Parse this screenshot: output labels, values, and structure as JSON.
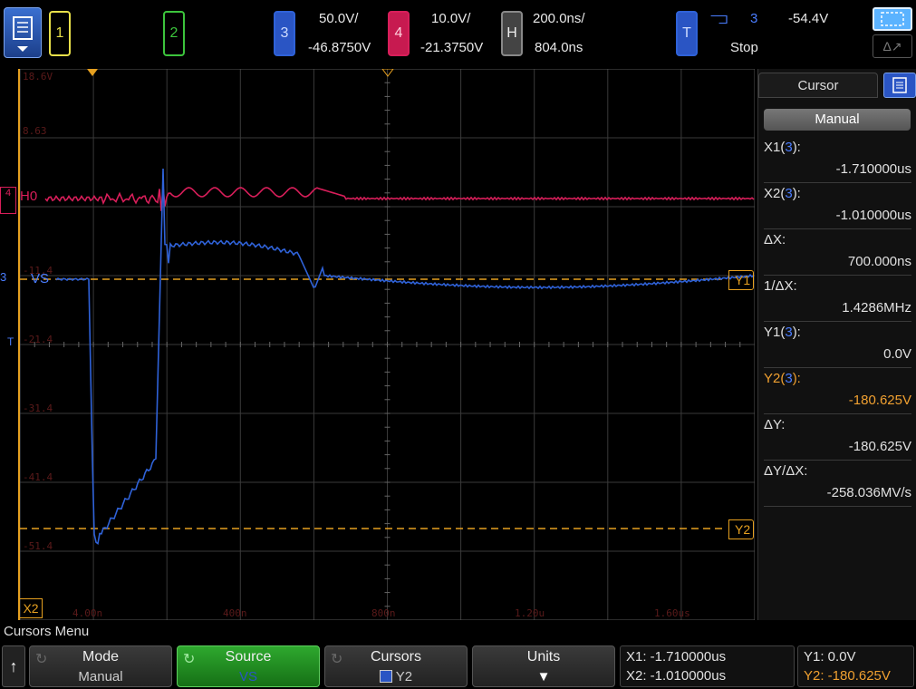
{
  "top": {
    "ch1_label": "1",
    "ch2_label": "2",
    "ch3_label": "3",
    "ch3_scale": "50.0V/",
    "ch3_offset": "-46.8750V",
    "ch4_label": "4",
    "ch4_scale": "10.0V/",
    "ch4_offset": "-21.3750V",
    "h_label": "H",
    "h_scale": "200.0ns/",
    "h_delay": "804.0ns",
    "t_label": "T",
    "trig_slope": "⫎",
    "trig_source": "3",
    "trig_level": "-54.4V",
    "run_state": "Stop",
    "cursor_tool2_glyph": "Δ↗"
  },
  "graticule": {
    "y_labels": [
      "18.6V",
      "8.63",
      "",
      "-11.4",
      "-21.4",
      "-31.4",
      "-41.4",
      "-51.4"
    ],
    "x_labels": [
      "4.00n",
      "400n",
      "800n",
      "1.20u",
      "1.60us"
    ],
    "markers": {
      "ch4_tag": "4",
      "ch4_name": "H0",
      "ch3_tag": "3",
      "ch3_name": "VS",
      "trig_tag": "T",
      "y1": "Y1",
      "y2": "Y2",
      "x2": "X2"
    }
  },
  "side": {
    "title": "Cursor",
    "mode_button": "Manual",
    "rows": [
      {
        "label": "X1(",
        "ch": "3",
        "end": "):",
        "value": "-1.710000us",
        "orange": false
      },
      {
        "label": "X2(",
        "ch": "3",
        "end": "):",
        "value": "-1.010000us",
        "orange": false
      },
      {
        "label": "ΔX:",
        "ch": "",
        "end": "",
        "value": "700.000ns",
        "orange": false
      },
      {
        "label": "1/ΔX:",
        "ch": "",
        "end": "",
        "value": "1.4286MHz",
        "orange": false
      },
      {
        "label": "Y1(",
        "ch": "3",
        "end": "):",
        "value": "0.0V",
        "orange": false
      },
      {
        "label": "Y2(",
        "ch": "3",
        "end": "):",
        "value": "-180.625V",
        "orange": true
      },
      {
        "label": "ΔY:",
        "ch": "",
        "end": "",
        "value": "-180.625V",
        "orange": false
      },
      {
        "label": "ΔY/ΔX:",
        "ch": "",
        "end": "",
        "value": "-258.036MV/s",
        "orange": false
      }
    ]
  },
  "bottom": {
    "menu_title": "Cursors Menu",
    "up_glyph": "↑",
    "mode": {
      "title": "Mode",
      "value": "Manual"
    },
    "source": {
      "title": "Source",
      "value": "VS"
    },
    "cursors": {
      "title": "Cursors",
      "value": "Y2"
    },
    "units": {
      "title": "Units",
      "value": "▼"
    },
    "readout_x1": "X1:  -1.710000us",
    "readout_x2": "X2:  -1.010000us",
    "readout_y1": "Y1: 0.0V",
    "readout_y2": "Y2: -180.625V"
  },
  "colors": {
    "ch3": "#2f62d8",
    "ch4": "#d81e5a",
    "cursor": "#e6a020",
    "grid": "#3a3a3a"
  }
}
